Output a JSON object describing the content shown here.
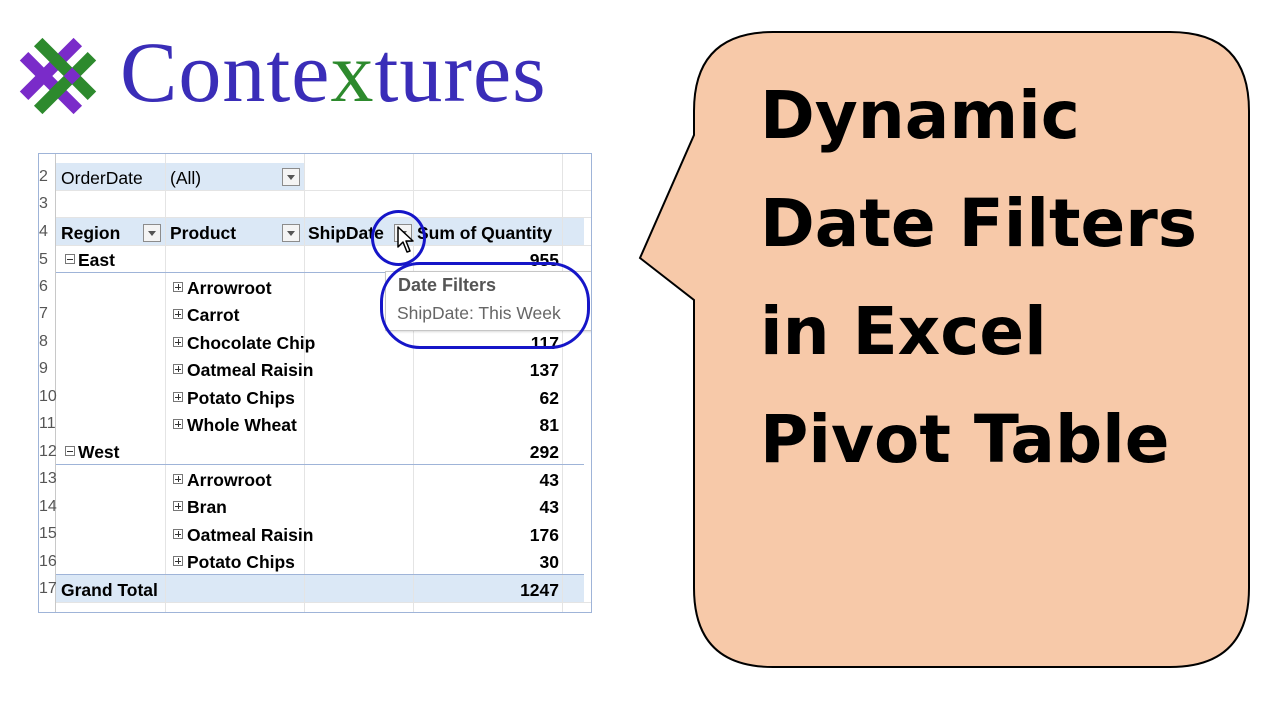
{
  "logo": {
    "text_part1": "Conte",
    "text_x": "x",
    "text_part2": "tures"
  },
  "sheet": {
    "row_numbers": [
      "2",
      "3",
      "4",
      "5",
      "6",
      "7",
      "8",
      "9",
      "10",
      "11",
      "12",
      "13",
      "14",
      "15",
      "16",
      "17"
    ],
    "filter": {
      "field": "OrderDate",
      "value": "(All)"
    },
    "headers": {
      "region": "Region",
      "product": "Product",
      "shipdate": "ShipDate",
      "sum": "Sum of Quantity"
    },
    "regions": [
      {
        "name": "East",
        "total": "955",
        "products": [
          {
            "name": "Arrowroot",
            "value": ""
          },
          {
            "name": "Carrot",
            "value": ""
          },
          {
            "name": "Chocolate Chip",
            "value": "117"
          },
          {
            "name": "Oatmeal Raisin",
            "value": "137"
          },
          {
            "name": "Potato Chips",
            "value": "62"
          },
          {
            "name": "Whole Wheat",
            "value": "81"
          }
        ]
      },
      {
        "name": "West",
        "total": "292",
        "products": [
          {
            "name": "Arrowroot",
            "value": "43"
          },
          {
            "name": "Bran",
            "value": "43"
          },
          {
            "name": "Oatmeal Raisin",
            "value": "176"
          },
          {
            "name": "Potato Chips",
            "value": "30"
          }
        ]
      }
    ],
    "grand_total": {
      "label": "Grand Total",
      "value": "1247"
    },
    "tooltip": {
      "title": "Date Filters",
      "subtitle": "ShipDate: This Week"
    }
  },
  "bubble": {
    "lines": [
      "Dynamic",
      "Date Filters",
      "in Excel",
      "Pivot Table"
    ]
  },
  "colors": {
    "logo_blue": "#3a2db8",
    "logo_green": "#2d8a2d",
    "logo_purple": "#7a2bc9",
    "bubble_fill": "#f7c9a9",
    "highlight_circle": "#1515c8",
    "pivot_band": "#dbe8f6"
  }
}
